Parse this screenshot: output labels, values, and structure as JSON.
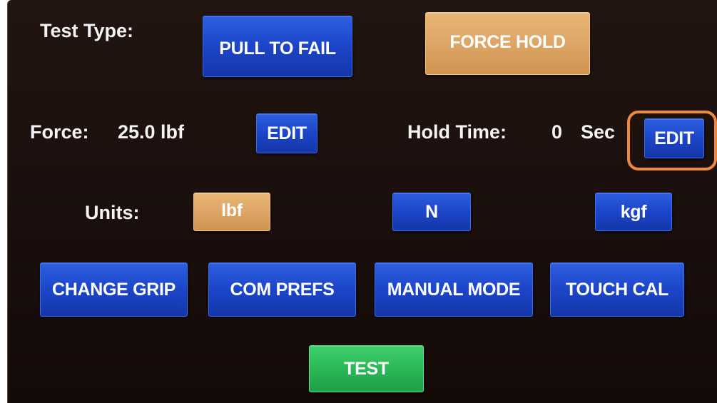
{
  "test_type": {
    "label": "Test Type:",
    "options": [
      {
        "label": "PULL TO FAIL",
        "selected": false
      },
      {
        "label": "FORCE HOLD",
        "selected": true
      }
    ]
  },
  "force": {
    "label": "Force:",
    "value": "25.0 lbf",
    "edit_label": "EDIT"
  },
  "hold_time": {
    "label": "Hold Time:",
    "value": "0",
    "unit": "Sec",
    "edit_label": "EDIT"
  },
  "units": {
    "label": "Units:",
    "options": [
      {
        "label": "lbf",
        "selected": true
      },
      {
        "label": "N",
        "selected": false
      },
      {
        "label": "kgf",
        "selected": false
      }
    ]
  },
  "actions": [
    {
      "label": "CHANGE GRIP"
    },
    {
      "label": "COM PREFS"
    },
    {
      "label": "MANUAL MODE"
    },
    {
      "label": "TOUCH CAL"
    }
  ],
  "test_button": {
    "label": "TEST"
  },
  "colors": {
    "selected": "#dda566",
    "unselected": "#1c45c8",
    "test": "#2bb857",
    "highlight": "#ef8a3a",
    "background": "#1b100d"
  }
}
